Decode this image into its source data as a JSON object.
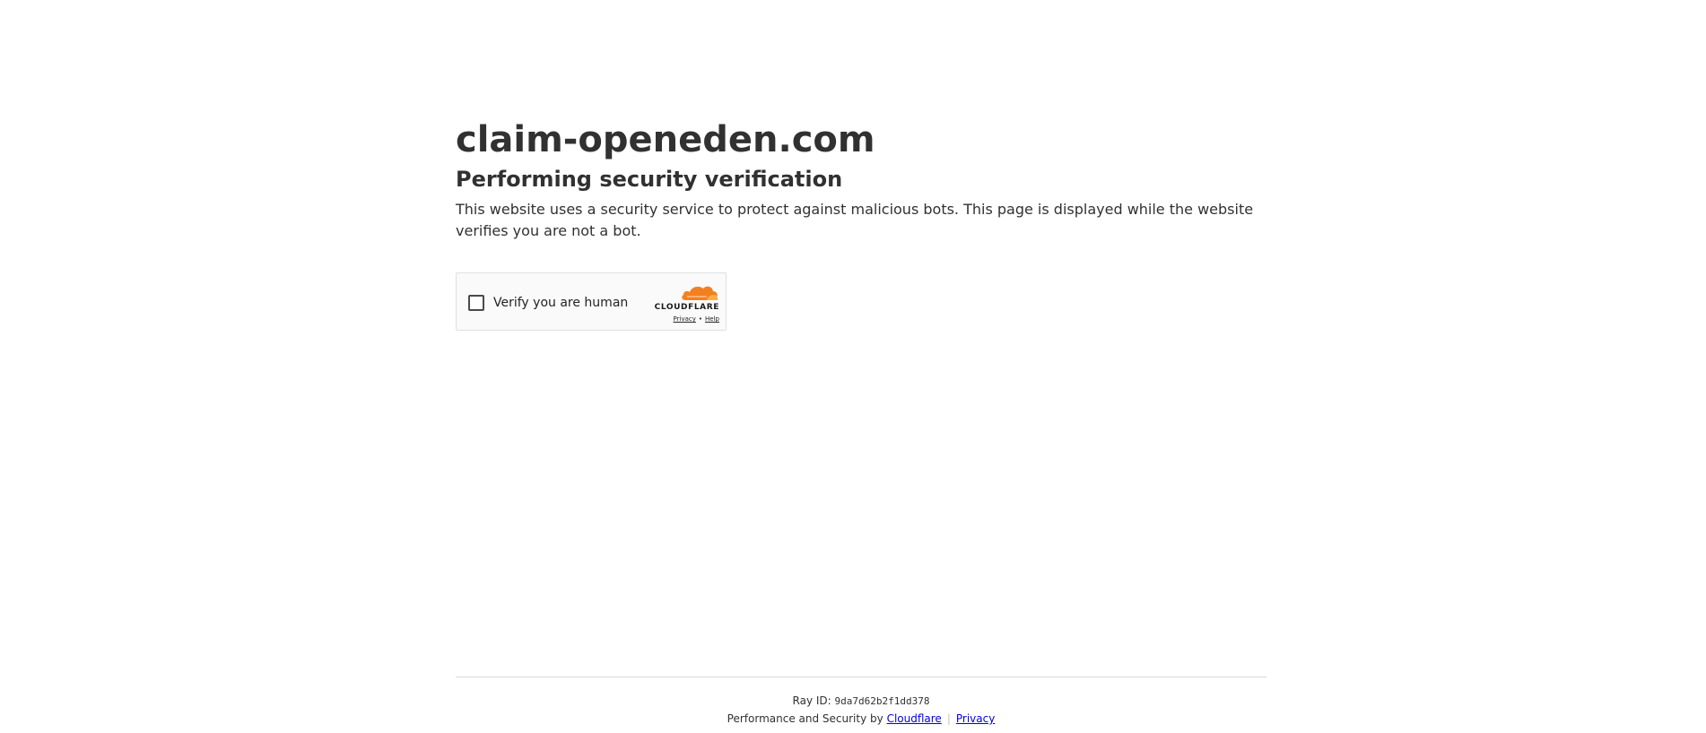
{
  "main": {
    "site_title": "claim-openeden.com",
    "heading": "Performing security verification",
    "description": "This website uses a security service to protect against malicious bots. This page is displayed while the website verifies you are not a bot."
  },
  "widget": {
    "checkbox_label": "Verify you are human",
    "brand_wordmark": "CLOUDFLARE",
    "privacy_link": "Privacy",
    "link_separator": "•",
    "help_link": "Help",
    "brand_color": "#f38020",
    "icon": "cloudflare-cloud-icon"
  },
  "footer": {
    "ray_label": "Ray ID:",
    "ray_id": "9da7d62b2f1dd378",
    "performance_text": "Performance and Security by",
    "cloudflare_link": "Cloudflare",
    "separator": "|",
    "privacy_link": "Privacy",
    "link_color": "#0000ee"
  }
}
